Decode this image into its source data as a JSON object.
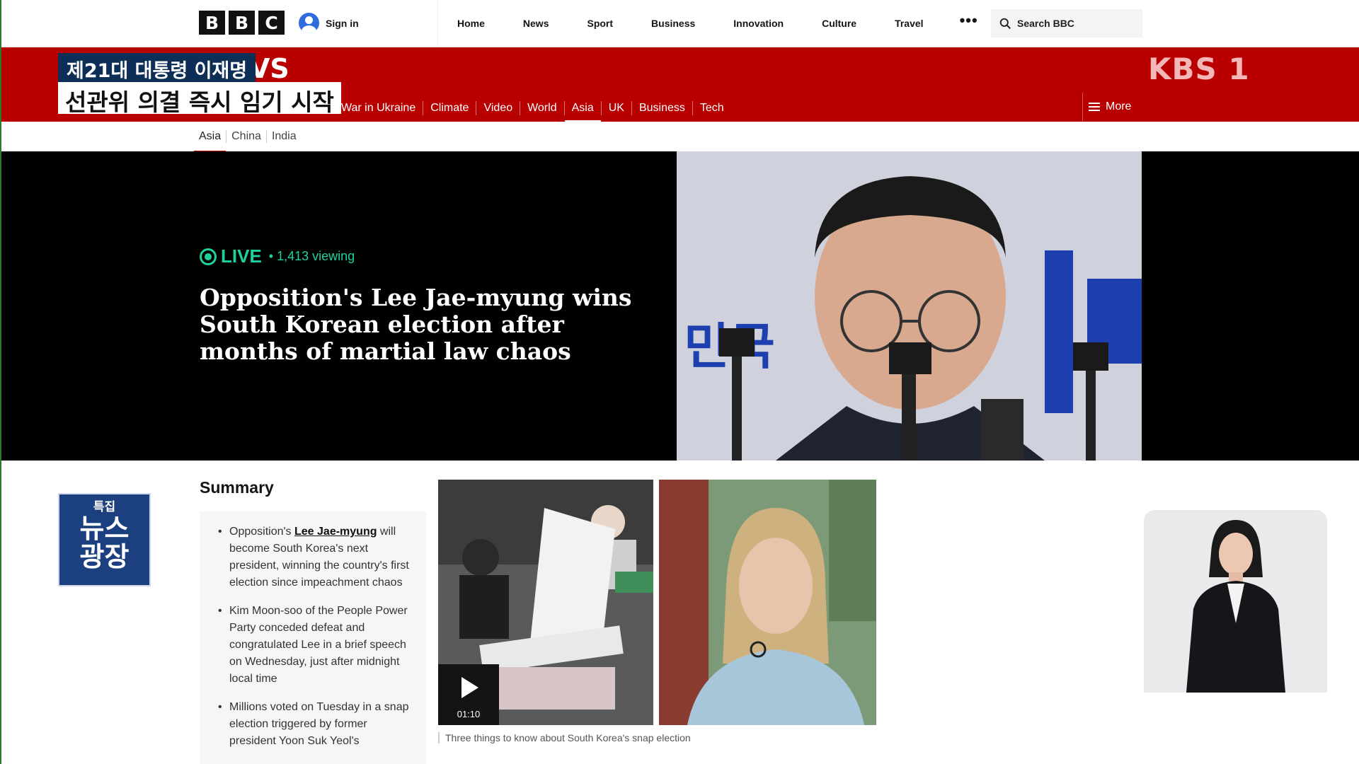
{
  "topbar": {
    "logo_letters": [
      "B",
      "B",
      "C"
    ],
    "signin_label": "Sign in",
    "nav": [
      "Home",
      "News",
      "Sport",
      "Business",
      "Innovation",
      "Culture",
      "Travel"
    ],
    "more_dots": "•••",
    "search_placeholder": "Search BBC"
  },
  "broadcast": {
    "channel": "KBS 1",
    "caption_top": "제21대 대통령 이재명",
    "caption_bottom": "선관위 의결 즉시 임기 시작",
    "vs_text": "VS",
    "program_badge_small": "특집",
    "program_badge_big_line1": "뉴스",
    "program_badge_big_line2": "광장"
  },
  "section_nav": {
    "items": [
      "War in Ukraine",
      "Climate",
      "Video",
      "World",
      "Asia",
      "UK",
      "Business",
      "Tech"
    ],
    "active": "Asia",
    "more_label": "More"
  },
  "sub_nav": {
    "items": [
      "Asia",
      "China",
      "India"
    ],
    "active": "Asia"
  },
  "hero": {
    "live_label": "LIVE",
    "viewing": "• 1,413 viewing",
    "headline": "Opposition's Lee Jae-myung wins South Korean election after months of martial law chaos",
    "image_alt": "Portrait banner of Lee Jae-myung with cameras in front"
  },
  "summary": {
    "title": "Summary",
    "bullets": [
      {
        "prefix": "Opposition's ",
        "link": "Lee Jae-myung",
        "suffix": " will become South Korea's next president, winning the country's first election since impeachment chaos"
      },
      {
        "text": "Kim Moon-soo of the People Power Party conceded defeat and congratulated Lee in a brief speech on Wednesday, just after midnight local time"
      },
      {
        "text": "Millions voted on Tuesday in a snap election triggered by former president Yoon Suk Yeol's"
      }
    ]
  },
  "media": {
    "video_duration": "01:10",
    "caption": "Three things to know about South Korea's snap election"
  },
  "colors": {
    "bbc_red": "#b80000",
    "live_green": "#1ed2a0",
    "caption_navy": "#0d2f57"
  }
}
